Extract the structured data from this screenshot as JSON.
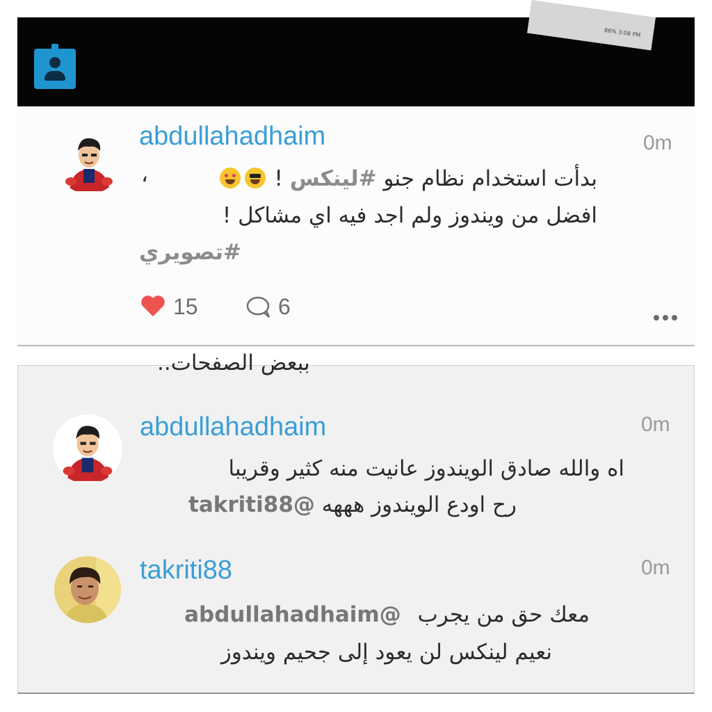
{
  "top_photo": {
    "screen_status": "86% 3:08 PM",
    "badge_icon": "profile-badge-icon"
  },
  "post": {
    "username": "abdullahadhaim",
    "time": "0m",
    "line1_text": "بدأت استخدام نظام جنو ",
    "line1_tag": "#لينكس",
    "line1_end": " ! ",
    "line1_comma": "،",
    "line2": "افضل من ويندوز ولم اجد فيه اي مشاكل !",
    "hashtag": "#تصويري",
    "likes": "15",
    "comments": "6"
  },
  "replies": {
    "cut_off_text": "ببعض الصفحات..",
    "items": [
      {
        "username": "abdullahadhaim",
        "time": "0m",
        "line1": "اه والله صادق الويندوز عانيت منه كثير وقريبا",
        "line2_text": "رح اودع الويندوز هههه",
        "line2_mention": "@takriti88"
      },
      {
        "username": "takriti88",
        "time": "0m",
        "line1_text": "معك حق من يجرب",
        "line1_mention": "@abdullahadhaim",
        "line2": "نعيم لينكس لن يعود إلى جحيم ويندوز"
      }
    ]
  },
  "colors": {
    "accent": "#3a9ed6",
    "badge": "#1f95cf",
    "heart": "#ef5350"
  }
}
